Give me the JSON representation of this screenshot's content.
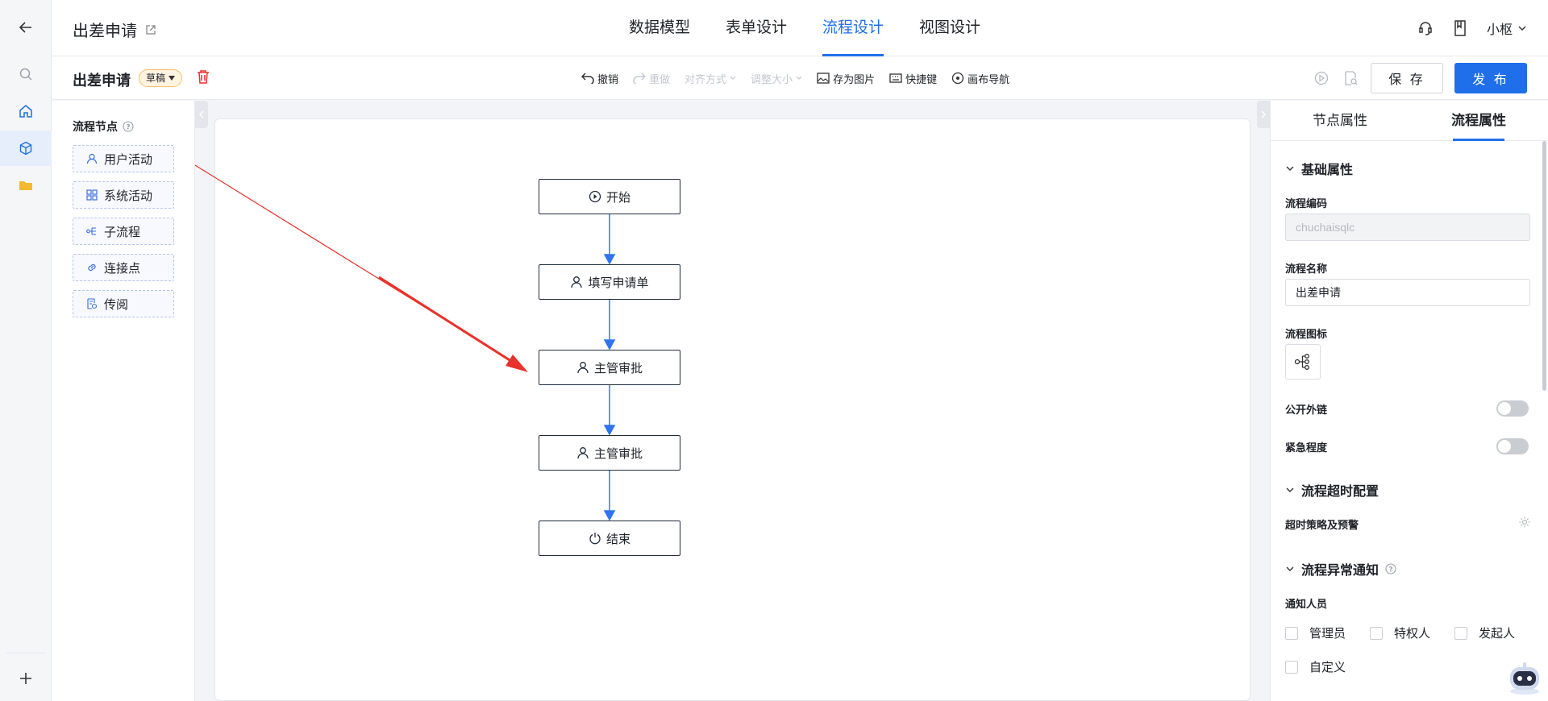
{
  "rail": {
    "items": [
      {
        "icon": "back-arrow-icon"
      },
      {
        "icon": "search-icon"
      },
      {
        "icon": "home-icon"
      },
      {
        "icon": "cube-icon",
        "active": true
      },
      {
        "icon": "folder-icon"
      },
      {
        "icon": "plus-icon"
      }
    ]
  },
  "header": {
    "app_title": "出差申请",
    "tabs": [
      {
        "label": "数据模型"
      },
      {
        "label": "表单设计"
      },
      {
        "label": "流程设计",
        "active": true
      },
      {
        "label": "视图设计"
      }
    ],
    "user_name": "小枢"
  },
  "toolbar": {
    "process_title": "出差申请",
    "status_badge": "草稿",
    "tools": {
      "undo": "撤销",
      "redo": "重做",
      "align": "对齐方式",
      "resize": "调整大小",
      "save_image": "存为图片",
      "shortcuts": "快捷键",
      "canvas_nav": "画布导航"
    },
    "save_label": "保 存",
    "publish_label": "发 布"
  },
  "palette": {
    "title": "流程节点",
    "items": [
      {
        "label": "用户活动",
        "icon": "user-icon"
      },
      {
        "label": "系统活动",
        "icon": "grid-icon"
      },
      {
        "label": "子流程",
        "icon": "subflow-icon"
      },
      {
        "label": "连接点",
        "icon": "link-icon"
      },
      {
        "label": "传阅",
        "icon": "circulate-icon"
      }
    ]
  },
  "flow": {
    "nodes": [
      {
        "label": "开始",
        "icon": "play-icon"
      },
      {
        "label": "填写申请单",
        "icon": "user-icon"
      },
      {
        "label": "主管审批",
        "icon": "user-icon"
      },
      {
        "label": "主管审批",
        "icon": "user-icon"
      },
      {
        "label": "结束",
        "icon": "power-icon"
      }
    ]
  },
  "right_panel": {
    "tabs": [
      {
        "label": "节点属性"
      },
      {
        "label": "流程属性",
        "active": true
      }
    ],
    "basic_section": "基础属性",
    "code_label": "流程编码",
    "code_value": "chuchaisqlc",
    "name_label": "流程名称",
    "name_value": "出差申请",
    "icon_label": "流程图标",
    "public_link_label": "公开外链",
    "public_link_on": false,
    "urgency_label": "紧急程度",
    "urgency_on": false,
    "timeout_section": "流程超时配置",
    "timeout_policy_label": "超时策略及预警",
    "exception_section": "流程异常通知",
    "notify_label": "通知人员",
    "notify_options": [
      {
        "label": "管理员",
        "checked": false
      },
      {
        "label": "特权人",
        "checked": false
      },
      {
        "label": "发起人",
        "checked": false
      },
      {
        "label": "自定义",
        "checked": false
      }
    ]
  },
  "colors": {
    "accent": "#1f6feb",
    "arrow_annotation": "#e8322b",
    "connector": "#2f74f0"
  }
}
